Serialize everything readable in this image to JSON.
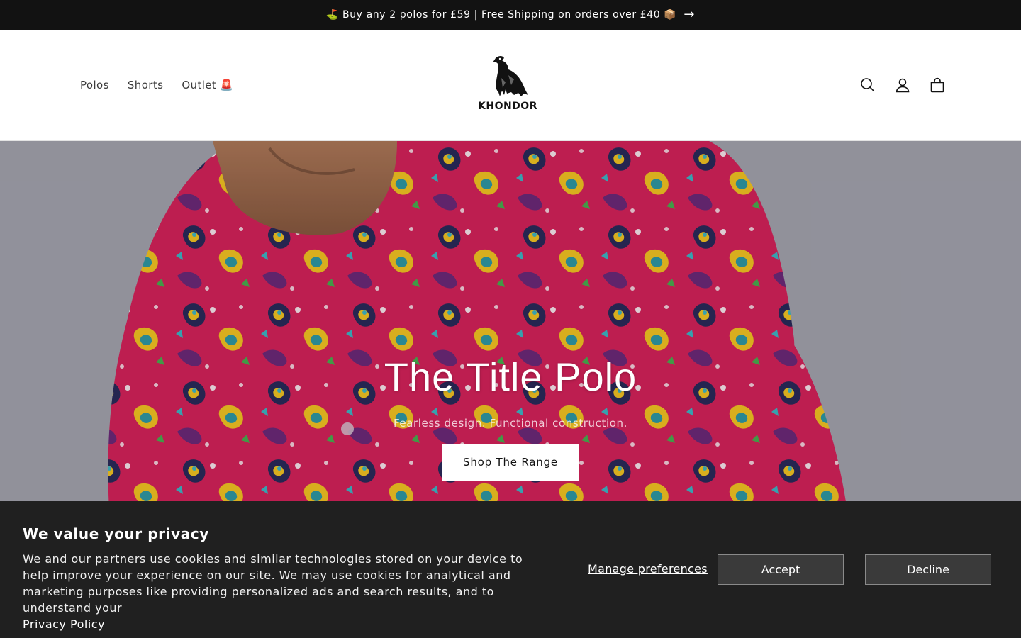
{
  "announcement": {
    "text": "⛳ Buy any 2 polos for £59 | Free Shipping on orders over £40 📦",
    "arrow": "→"
  },
  "header": {
    "nav": [
      {
        "label": "Polos"
      },
      {
        "label": "Shorts"
      },
      {
        "label": "Outlet 🚨"
      }
    ],
    "logo_text": "KHONDOR",
    "icons": [
      "search-icon",
      "account-icon",
      "cart-icon"
    ]
  },
  "hero": {
    "title": "The Title Polo",
    "subtitle": "Fearless design. Functional construction.",
    "button_label": "Shop The Range"
  },
  "cookie_banner": {
    "title": "We value your privacy",
    "text": "We and our partners use cookies and similar technologies stored on your device to help improve your experience on our site. We may use cookies for analytical and marketing purposes like providing personalized ads and search results, and to understand your",
    "privacy_link": "Privacy Policy",
    "manage_label": "Manage preferences",
    "accept_label": "Accept",
    "decline_label": "Decline"
  },
  "colors": {
    "announcement_bg": "#121212",
    "banner_bg": "#202020",
    "shirt_pink": "#e0245e"
  }
}
